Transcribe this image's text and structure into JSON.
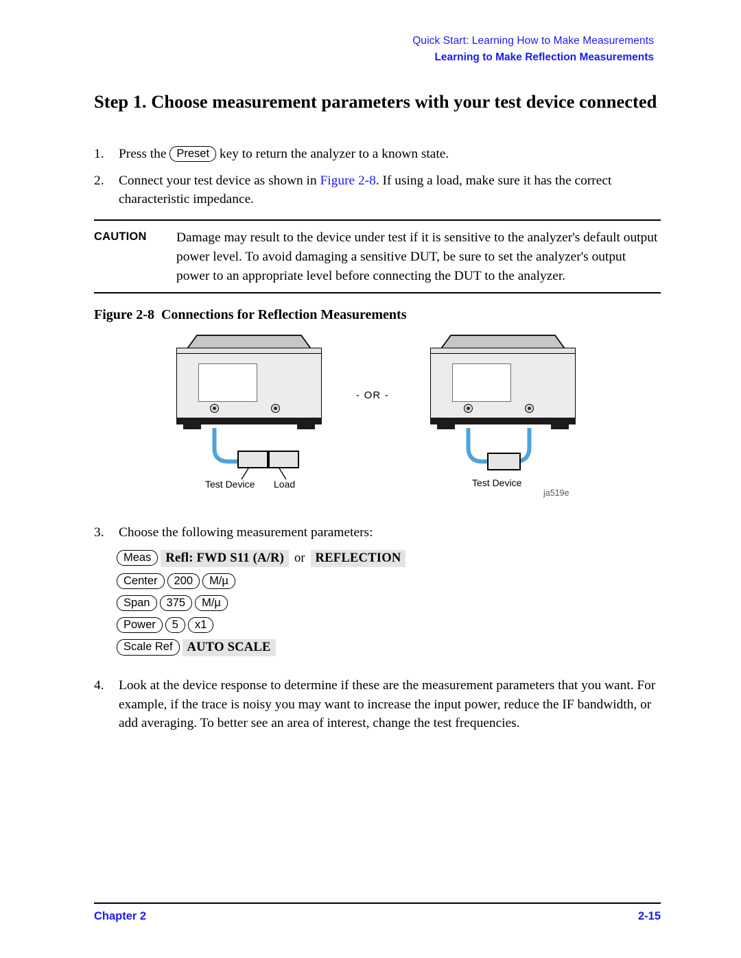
{
  "header": {
    "line1": "Quick Start: Learning How to Make Measurements",
    "line2": "Learning to Make Reflection Measurements"
  },
  "heading": {
    "line1": "Step 1. Choose measurement parameters with your test device",
    "line2": "connected"
  },
  "steps": {
    "item1": {
      "num": "1.",
      "text_before": "Press the",
      "key": "Preset",
      "text_after": "key to return the analyzer to a known state."
    },
    "item2": {
      "num": "2.",
      "text_before": "Connect your test device as shown in",
      "link": "Figure 2-8",
      "text_after": ". If using a load, make sure it has the correct characteristic impedance."
    },
    "item3": {
      "num": "3.",
      "text": "Choose the following measurement parameters:"
    },
    "item4": {
      "num": "4.",
      "text": "Look at the device response to determine if these are the measurement parameters that you want. For example, if the trace is noisy you may want to increase the input power, reduce the IF bandwidth, or add averaging. To better see an area of interest, change the test frequencies."
    }
  },
  "caution": {
    "label": "CAUTION",
    "text": "Damage may result to the device under test if it is sensitive to the analyzer's default output power level. To avoid damaging a sensitive DUT, be sure to set the analyzer's output power to an appropriate level before connecting the DUT to the analyzer."
  },
  "figure": {
    "caption_number": "Figure 2-8",
    "caption_title": "Connections for Reflection Measurements",
    "or_label": "- OR -",
    "artwork_id": "ja519e",
    "left_diagram": {
      "test_device_label": "Test Device",
      "load_label": "Load"
    },
    "right_diagram": {
      "test_device_label": "Test Device"
    },
    "cable_color": "#4fa3d9",
    "instrument_face_color": "#ececec"
  },
  "key_sequences": [
    {
      "keys": [
        "Meas"
      ],
      "softkeys": [
        "Refl: FWD S11 (A/R)",
        "REFLECTION"
      ],
      "separator": "or"
    },
    {
      "keys": [
        "Center",
        "200",
        "M/µ"
      ],
      "softkeys": [],
      "separator": ""
    },
    {
      "keys": [
        "Span",
        "375",
        "M/µ"
      ],
      "softkeys": [],
      "separator": ""
    },
    {
      "keys": [
        "Power",
        "5",
        "x1"
      ],
      "softkeys": [],
      "separator": ""
    },
    {
      "keys": [
        "Scale Ref"
      ],
      "softkeys": [
        "AUTO SCALE"
      ],
      "separator": ""
    }
  ],
  "footer": {
    "chapter": "Chapter 2",
    "page": "2-15"
  },
  "colors": {
    "link": "#1a1aee",
    "cable": "#4fa3d9",
    "softkey_bg": "#e4e4e4"
  }
}
